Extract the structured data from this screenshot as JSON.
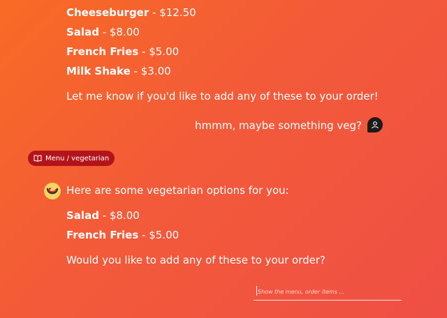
{
  "menu_top": {
    "items": [
      {
        "name": "Cheeseburger",
        "price": "$12.50"
      },
      {
        "name": "Salad",
        "price": "$8.00"
      },
      {
        "name": "French Fries",
        "price": "$5.00"
      },
      {
        "name": "Milk Shake",
        "price": "$3.00"
      }
    ],
    "separator": " - ",
    "followup": "Let me know if you'd like to add any of these to your order!"
  },
  "user_message": {
    "text": "hmmm, maybe something veg?",
    "avatar_icon": "user-icon"
  },
  "tool_call": {
    "label": "Menu / vegetarian",
    "icon": "book-open-icon"
  },
  "bot_reply": {
    "intro": "Here are some vegetarian options for you:",
    "items": [
      {
        "name": "Salad",
        "price": "$8.00"
      },
      {
        "name": "French Fries",
        "price": "$5.00"
      }
    ],
    "separator": " - ",
    "followup": "Would you like to add any of these to your order?",
    "avatar_icon": "smiley-bot-icon"
  },
  "composer": {
    "placeholder": "Show the menu, order items ..."
  },
  "colors": {
    "chip": "#b3141b",
    "user_avatar": "#1e1a1a",
    "bot_avatar": "#f6d365"
  }
}
